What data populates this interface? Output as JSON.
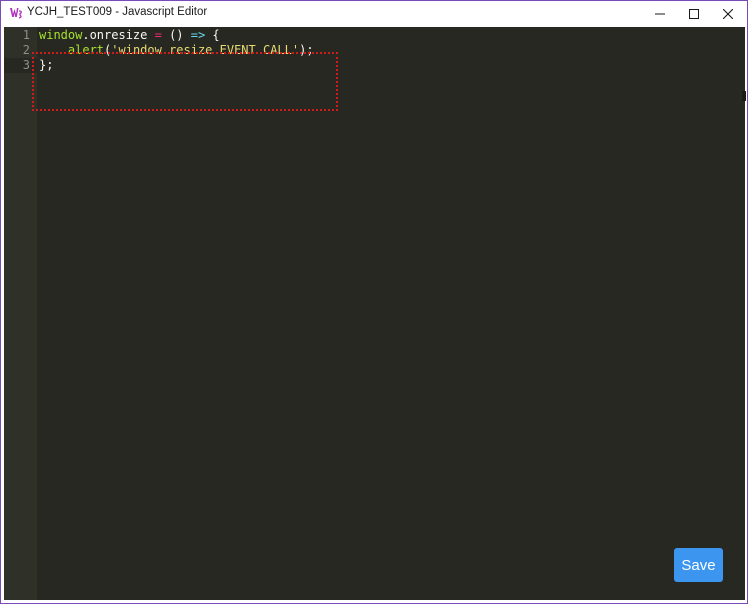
{
  "window": {
    "title": "YCJH_TEST009 - Javascript Editor",
    "app_icon": "app-logo-icon",
    "controls": {
      "minimize": "minimize-icon",
      "maximize": "maximize-icon",
      "close": "close-icon"
    }
  },
  "editor": {
    "line_numbers": [
      "1",
      "2",
      "3"
    ],
    "lines": [
      {
        "tokens": [
          {
            "text": "window",
            "kind": "var"
          },
          {
            "text": ".onresize ",
            "kind": "prop"
          },
          {
            "text": "=",
            "kind": "op"
          },
          {
            "text": " () ",
            "kind": "pun"
          },
          {
            "text": "=>",
            "kind": "arrow"
          },
          {
            "text": " {",
            "kind": "pun"
          }
        ]
      },
      {
        "tokens": [
          {
            "text": "    ",
            "kind": "pun"
          },
          {
            "text": "alert",
            "kind": "fn"
          },
          {
            "text": "(",
            "kind": "pun"
          },
          {
            "text": "'window resize EVENT CALL'",
            "kind": "str"
          },
          {
            "text": ");",
            "kind": "pun"
          }
        ]
      },
      {
        "tokens": [
          {
            "text": "};",
            "kind": "pun"
          }
        ]
      }
    ],
    "active_line": "3"
  },
  "footer": {
    "save_label": "Save"
  },
  "colors": {
    "editor_bg": "#272822",
    "gutter_bg": "#2f3129",
    "accent_button": "#3c96f0",
    "window_border": "#7a4bb8",
    "annotation": "#d11a1a"
  }
}
